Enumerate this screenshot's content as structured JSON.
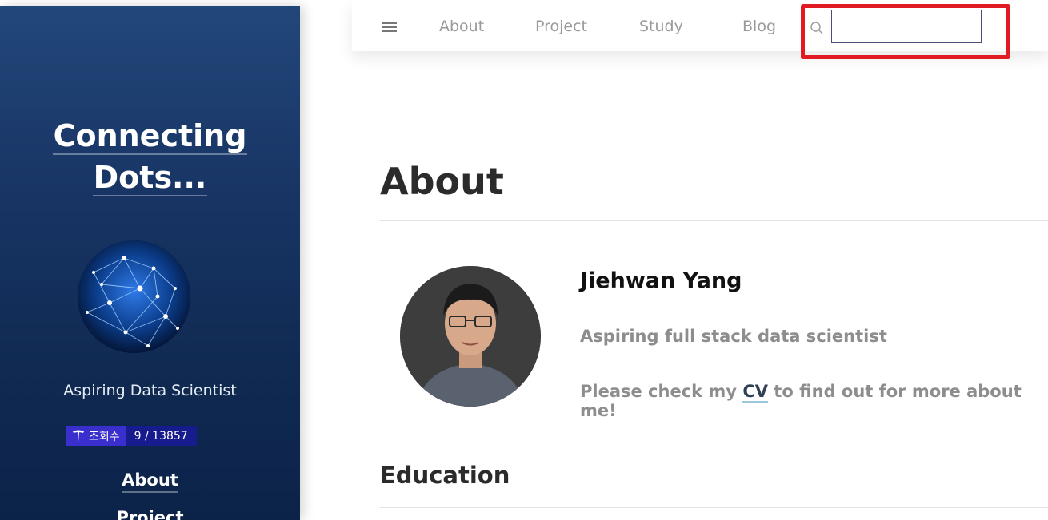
{
  "sidebar": {
    "title_line1": "Connecting",
    "title_line2": "Dots...",
    "avatar": "network-globe-image",
    "tagline": "Aspiring Data Scientist",
    "hit_counter": {
      "label": "조회수",
      "value": "9 / 13857"
    },
    "nav": [
      {
        "label": "About"
      },
      {
        "label": "Project"
      }
    ]
  },
  "topbar": {
    "menu_icon": "hamburger-menu-icon",
    "nav": [
      {
        "label": "About"
      },
      {
        "label": "Project"
      },
      {
        "label": "Study"
      },
      {
        "label": "Blog"
      }
    ],
    "search_icon": "search-icon",
    "search_value": ""
  },
  "main": {
    "page_title": "About",
    "profile": {
      "name": "Jiehwan Yang",
      "subtitle": "Aspiring full stack data scientist",
      "cv_prefix": "Please check my ",
      "cv_link": "CV",
      "cv_suffix": " to find out for more about me!"
    },
    "section_heading": "Education"
  },
  "colors": {
    "sidebar_top": "#22477a",
    "sidebar_bottom": "#0c2349",
    "highlight": "#e01b22",
    "counter_label": "#3a2fcd",
    "counter_value": "#161c8e"
  }
}
